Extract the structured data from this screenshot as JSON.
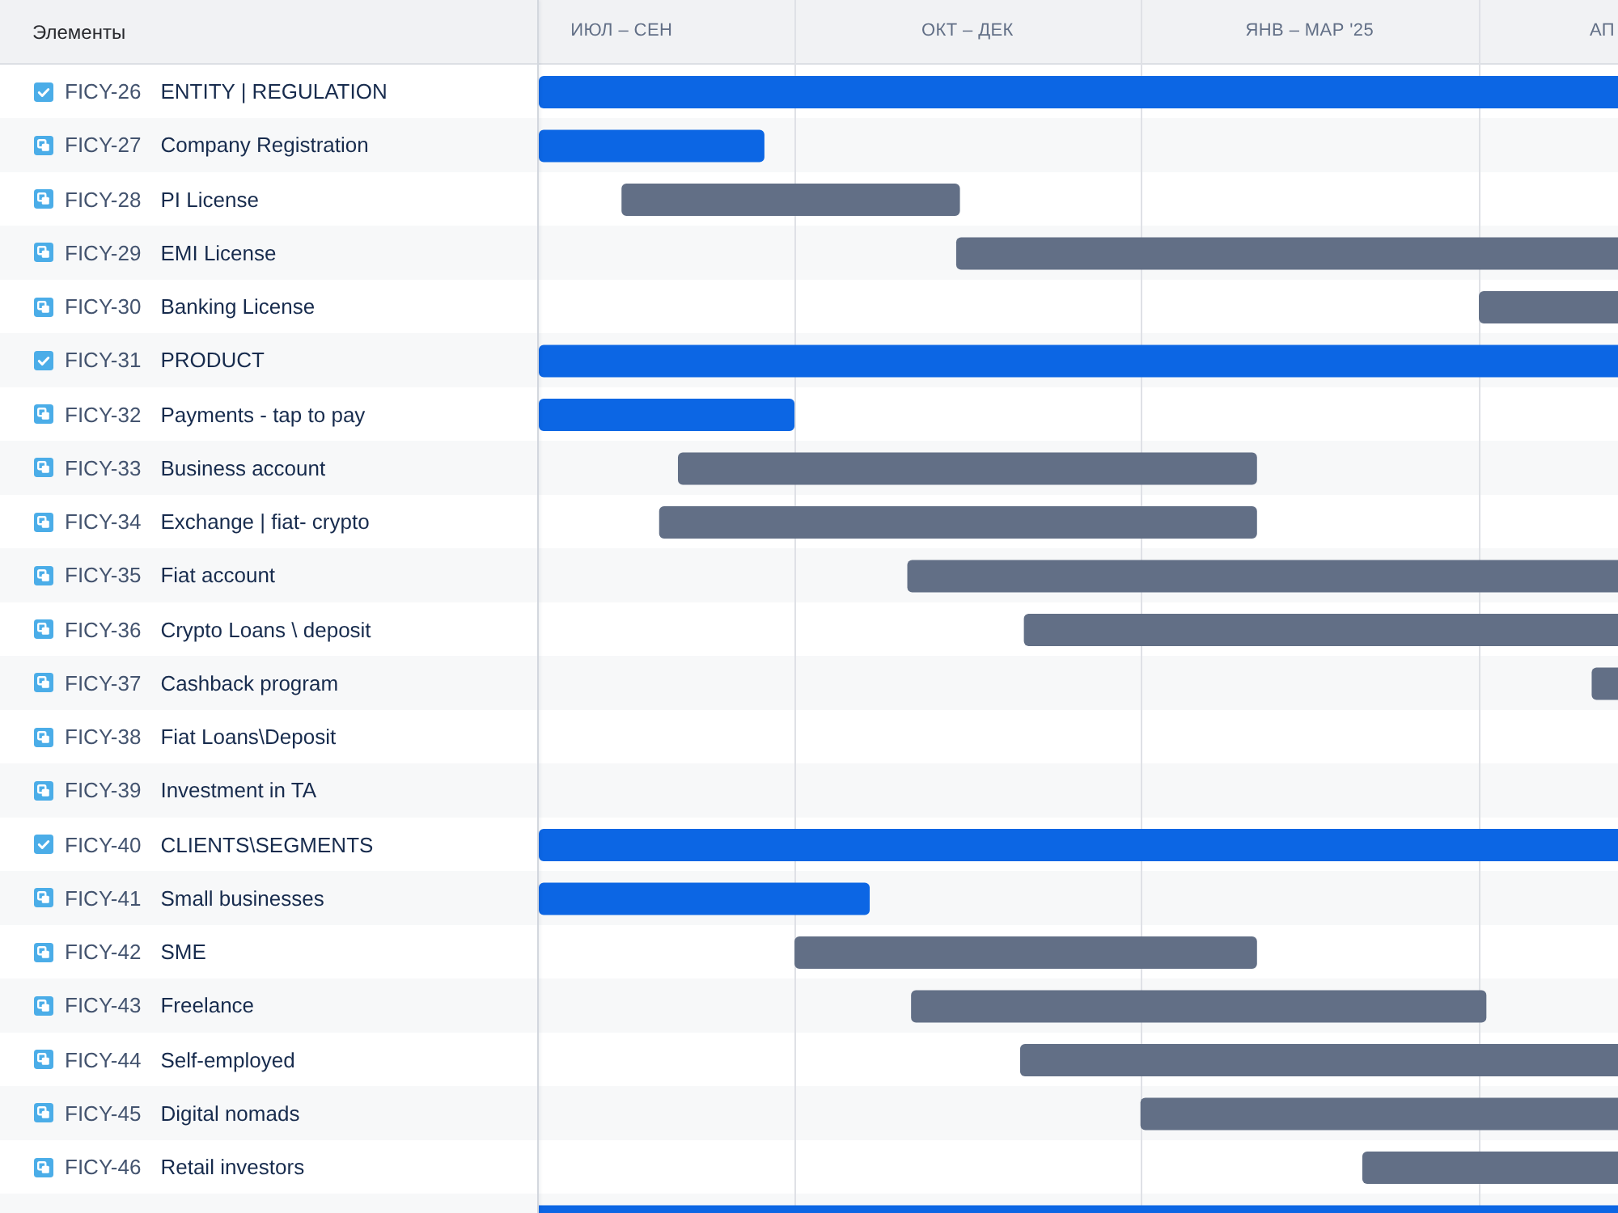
{
  "issues_panel": {
    "header": "Элементы"
  },
  "timeline": {
    "quarters": [
      "ИЮЛ – СЕН",
      "ОКТ – ДЕК",
      "ЯНВ – МАР '25",
      "АП"
    ]
  },
  "rows": [
    {
      "kind": "task",
      "key": "FICY-26",
      "title": "ENTITY | REGULATION",
      "bar": {
        "color": "#0c66e4"
      }
    },
    {
      "kind": "subtask",
      "key": "FICY-27",
      "title": "Company Registration",
      "bar": {
        "color": "#0c66e4"
      }
    },
    {
      "kind": "subtask",
      "key": "FICY-28",
      "title": "PI License",
      "bar": {
        "color": "#626f86"
      }
    },
    {
      "kind": "subtask",
      "key": "FICY-29",
      "title": "EMI License",
      "bar": {
        "color": "#626f86"
      }
    },
    {
      "kind": "subtask",
      "key": "FICY-30",
      "title": "Banking License",
      "bar": {
        "color": "#626f86"
      }
    },
    {
      "kind": "task",
      "key": "FICY-31",
      "title": "PRODUCT",
      "bar": {
        "color": "#0c66e4"
      }
    },
    {
      "kind": "subtask",
      "key": "FICY-32",
      "title": "Payments - tap to pay",
      "bar": {
        "color": "#0c66e4"
      }
    },
    {
      "kind": "subtask",
      "key": "FICY-33",
      "title": "Business account",
      "bar": {
        "color": "#626f86"
      }
    },
    {
      "kind": "subtask",
      "key": "FICY-34",
      "title": "Exchange | fiat- crypto",
      "bar": {
        "color": "#626f86"
      }
    },
    {
      "kind": "subtask",
      "key": "FICY-35",
      "title": "Fiat account",
      "bar": {
        "color": "#626f86"
      }
    },
    {
      "kind": "subtask",
      "key": "FICY-36",
      "title": "Crypto Loans \\ deposit",
      "bar": {
        "color": "#626f86"
      }
    },
    {
      "kind": "subtask",
      "key": "FICY-37",
      "title": "Cashback program",
      "bar": {
        "color": "#626f86"
      }
    },
    {
      "kind": "subtask",
      "key": "FICY-38",
      "title": "Fiat Loans\\Deposit"
    },
    {
      "kind": "subtask",
      "key": "FICY-39",
      "title": "Investment in TA"
    },
    {
      "kind": "task",
      "key": "FICY-40",
      "title": "CLIENTS\\SEGMENTS",
      "bar": {
        "color": "#0c66e4"
      }
    },
    {
      "kind": "subtask",
      "key": "FICY-41",
      "title": "Small businesses",
      "bar": {
        "color": "#0c66e4"
      }
    },
    {
      "kind": "subtask",
      "key": "FICY-42",
      "title": "SME",
      "bar": {
        "color": "#626f86"
      }
    },
    {
      "kind": "subtask",
      "key": "FICY-43",
      "title": "Freelance",
      "bar": {
        "color": "#626f86"
      }
    },
    {
      "kind": "subtask",
      "key": "FICY-44",
      "title": "Self-employed",
      "bar": {
        "color": "#626f86"
      }
    },
    {
      "kind": "subtask",
      "key": "FICY-45",
      "title": "Digital nomads",
      "bar": {
        "color": "#626f86"
      }
    },
    {
      "kind": "subtask",
      "key": "FICY-46",
      "title": "Retail investors",
      "bar": {
        "color": "#626f86"
      }
    },
    {
      "bar": {
        "color": "#0c66e4"
      }
    }
  ]
}
